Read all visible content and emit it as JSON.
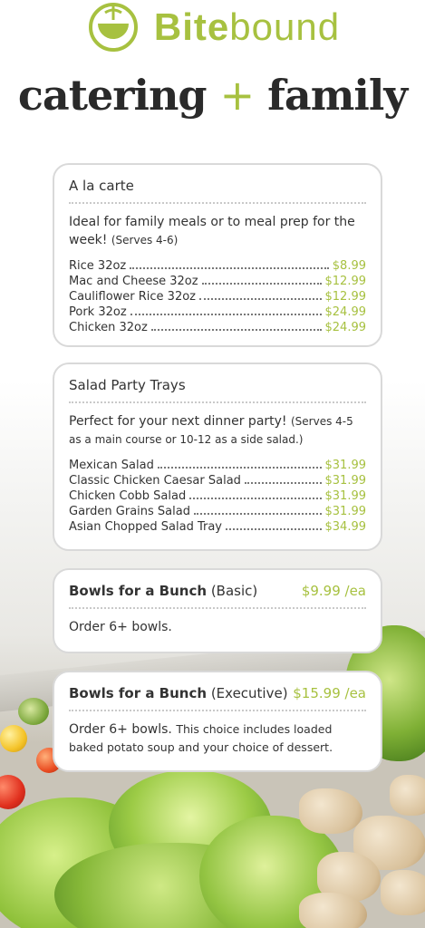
{
  "brand": {
    "name_bold": "Bite",
    "name_light": "bound"
  },
  "title": {
    "left": "catering",
    "plus": "+",
    "right": "family"
  },
  "colors": {
    "accent": "#a7c140",
    "text": "#333333"
  },
  "a_la_carte": {
    "heading": "A la carte",
    "desc": "Ideal for family meals or to meal prep for the week!",
    "note": "(Serves 4-6)",
    "items": [
      {
        "name": "Rice 32oz",
        "price": "$8.99"
      },
      {
        "name": "Mac and Cheese 32oz",
        "price": "$12.99"
      },
      {
        "name": "Cauliflower Rice 32oz",
        "price": "$12.99"
      },
      {
        "name": "Pork 32oz",
        "price": "$24.99"
      },
      {
        "name": "Chicken 32oz",
        "price": "$24.99"
      }
    ]
  },
  "salad": {
    "heading": "Salad Party Trays",
    "desc": "Perfect for your next dinner party!",
    "note": "(Serves 4-5 as a main course or 10-12 as a side salad.)",
    "items": [
      {
        "name": "Mexican Salad",
        "price": "$31.99"
      },
      {
        "name": "Classic Chicken Caesar Salad",
        "price": "$31.99"
      },
      {
        "name": "Chicken Cobb Salad",
        "price": "$31.99"
      },
      {
        "name": "Garden Grains Salad",
        "price": "$31.99"
      },
      {
        "name": "Asian Chopped Salad Tray",
        "price": "$34.99"
      }
    ]
  },
  "bowls_basic": {
    "heading_bold": "Bowls for a Bunch",
    "heading_light": "(Basic)",
    "price": "$9.99 /ea",
    "desc": "Order 6+ bowls."
  },
  "bowls_exec": {
    "heading_bold": "Bowls for a Bunch",
    "heading_light": "(Executive)",
    "price": "$15.99 /ea",
    "desc": "Order 6+ bowls.",
    "note": "This choice includes loaded baked potato soup and your choice of dessert."
  },
  "icons": [
    "bowl-logo-icon"
  ]
}
